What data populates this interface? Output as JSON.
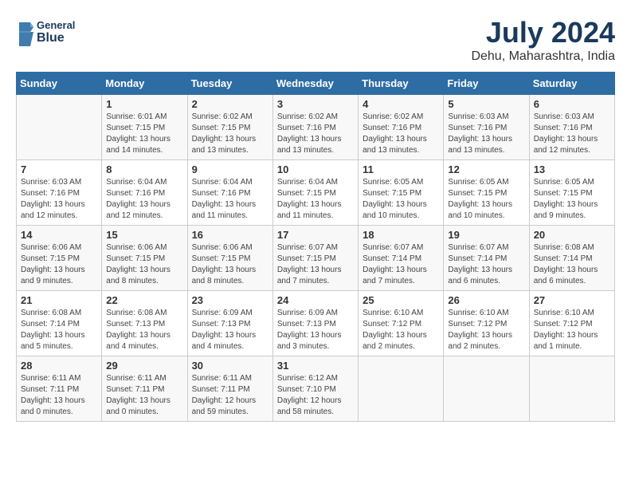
{
  "logo": {
    "line1": "General",
    "line2": "Blue"
  },
  "title": "July 2024",
  "location": "Dehu, Maharashtra, India",
  "days_of_week": [
    "Sunday",
    "Monday",
    "Tuesday",
    "Wednesday",
    "Thursday",
    "Friday",
    "Saturday"
  ],
  "weeks": [
    [
      {
        "day": "",
        "sunrise": "",
        "sunset": "",
        "daylight": ""
      },
      {
        "day": "1",
        "sunrise": "6:01 AM",
        "sunset": "7:15 PM",
        "daylight": "13 hours and 14 minutes."
      },
      {
        "day": "2",
        "sunrise": "6:02 AM",
        "sunset": "7:15 PM",
        "daylight": "13 hours and 13 minutes."
      },
      {
        "day": "3",
        "sunrise": "6:02 AM",
        "sunset": "7:16 PM",
        "daylight": "13 hours and 13 minutes."
      },
      {
        "day": "4",
        "sunrise": "6:02 AM",
        "sunset": "7:16 PM",
        "daylight": "13 hours and 13 minutes."
      },
      {
        "day": "5",
        "sunrise": "6:03 AM",
        "sunset": "7:16 PM",
        "daylight": "13 hours and 13 minutes."
      },
      {
        "day": "6",
        "sunrise": "6:03 AM",
        "sunset": "7:16 PM",
        "daylight": "13 hours and 12 minutes."
      }
    ],
    [
      {
        "day": "7",
        "sunrise": "6:03 AM",
        "sunset": "7:16 PM",
        "daylight": "13 hours and 12 minutes."
      },
      {
        "day": "8",
        "sunrise": "6:04 AM",
        "sunset": "7:16 PM",
        "daylight": "13 hours and 12 minutes."
      },
      {
        "day": "9",
        "sunrise": "6:04 AM",
        "sunset": "7:16 PM",
        "daylight": "13 hours and 11 minutes."
      },
      {
        "day": "10",
        "sunrise": "6:04 AM",
        "sunset": "7:15 PM",
        "daylight": "13 hours and 11 minutes."
      },
      {
        "day": "11",
        "sunrise": "6:05 AM",
        "sunset": "7:15 PM",
        "daylight": "13 hours and 10 minutes."
      },
      {
        "day": "12",
        "sunrise": "6:05 AM",
        "sunset": "7:15 PM",
        "daylight": "13 hours and 10 minutes."
      },
      {
        "day": "13",
        "sunrise": "6:05 AM",
        "sunset": "7:15 PM",
        "daylight": "13 hours and 9 minutes."
      }
    ],
    [
      {
        "day": "14",
        "sunrise": "6:06 AM",
        "sunset": "7:15 PM",
        "daylight": "13 hours and 9 minutes."
      },
      {
        "day": "15",
        "sunrise": "6:06 AM",
        "sunset": "7:15 PM",
        "daylight": "13 hours and 8 minutes."
      },
      {
        "day": "16",
        "sunrise": "6:06 AM",
        "sunset": "7:15 PM",
        "daylight": "13 hours and 8 minutes."
      },
      {
        "day": "17",
        "sunrise": "6:07 AM",
        "sunset": "7:15 PM",
        "daylight": "13 hours and 7 minutes."
      },
      {
        "day": "18",
        "sunrise": "6:07 AM",
        "sunset": "7:14 PM",
        "daylight": "13 hours and 7 minutes."
      },
      {
        "day": "19",
        "sunrise": "6:07 AM",
        "sunset": "7:14 PM",
        "daylight": "13 hours and 6 minutes."
      },
      {
        "day": "20",
        "sunrise": "6:08 AM",
        "sunset": "7:14 PM",
        "daylight": "13 hours and 6 minutes."
      }
    ],
    [
      {
        "day": "21",
        "sunrise": "6:08 AM",
        "sunset": "7:14 PM",
        "daylight": "13 hours and 5 minutes."
      },
      {
        "day": "22",
        "sunrise": "6:08 AM",
        "sunset": "7:13 PM",
        "daylight": "13 hours and 4 minutes."
      },
      {
        "day": "23",
        "sunrise": "6:09 AM",
        "sunset": "7:13 PM",
        "daylight": "13 hours and 4 minutes."
      },
      {
        "day": "24",
        "sunrise": "6:09 AM",
        "sunset": "7:13 PM",
        "daylight": "13 hours and 3 minutes."
      },
      {
        "day": "25",
        "sunrise": "6:10 AM",
        "sunset": "7:12 PM",
        "daylight": "13 hours and 2 minutes."
      },
      {
        "day": "26",
        "sunrise": "6:10 AM",
        "sunset": "7:12 PM",
        "daylight": "13 hours and 2 minutes."
      },
      {
        "day": "27",
        "sunrise": "6:10 AM",
        "sunset": "7:12 PM",
        "daylight": "13 hours and 1 minute."
      }
    ],
    [
      {
        "day": "28",
        "sunrise": "6:11 AM",
        "sunset": "7:11 PM",
        "daylight": "13 hours and 0 minutes."
      },
      {
        "day": "29",
        "sunrise": "6:11 AM",
        "sunset": "7:11 PM",
        "daylight": "13 hours and 0 minutes."
      },
      {
        "day": "30",
        "sunrise": "6:11 AM",
        "sunset": "7:11 PM",
        "daylight": "12 hours and 59 minutes."
      },
      {
        "day": "31",
        "sunrise": "6:12 AM",
        "sunset": "7:10 PM",
        "daylight": "12 hours and 58 minutes."
      },
      {
        "day": "",
        "sunrise": "",
        "sunset": "",
        "daylight": ""
      },
      {
        "day": "",
        "sunrise": "",
        "sunset": "",
        "daylight": ""
      },
      {
        "day": "",
        "sunrise": "",
        "sunset": "",
        "daylight": ""
      }
    ]
  ]
}
